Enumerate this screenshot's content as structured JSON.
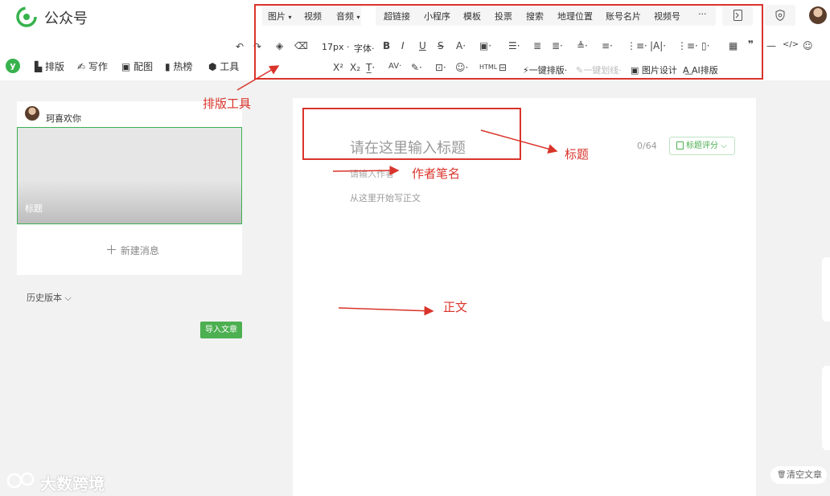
{
  "header": {
    "brand": "公众号",
    "insert_menu": [
      {
        "label": "图片",
        "arrow": "▾"
      },
      {
        "label": "视频",
        "arrow": ""
      },
      {
        "label": "音频",
        "arrow": "▾"
      },
      {
        "label": "超链接",
        "arrow": ""
      },
      {
        "label": "小程序",
        "arrow": ""
      },
      {
        "label": "模板",
        "arrow": ""
      },
      {
        "label": "投票",
        "arrow": ""
      },
      {
        "label": "搜索",
        "arrow": ""
      },
      {
        "label": "地理位置",
        "arrow": ""
      },
      {
        "label": "账号名片",
        "arrow": ""
      },
      {
        "label": "视频号",
        "arrow": ""
      },
      {
        "label": "···",
        "arrow": ""
      }
    ]
  },
  "format_toolbar": {
    "font_size": "17px",
    "font_family": "字体",
    "one_click_layout": "一键排版",
    "image_design": "图片设计",
    "ai_layout": "AI排版",
    "dim_label": "一键划线"
  },
  "features": [
    "排版",
    "写作",
    "配图",
    "热榜",
    "工具"
  ],
  "left_panel": {
    "author": "珂喜欢你",
    "cover_title": "标题",
    "new_message": "新建消息",
    "history": "历史版本",
    "import": "导入文章"
  },
  "editor": {
    "title_placeholder": "请在这里输入标题",
    "counter": "0/64",
    "title_score": "标题评分",
    "author_placeholder": "请输入作者",
    "body_placeholder": "从这里开始写正文"
  },
  "annotations": {
    "toolbar": "排版工具",
    "title": "标题",
    "author": "作者笔名",
    "body": "正文",
    "color": "#d9342b"
  },
  "footer": {
    "clear": "清空文章",
    "watermark": "大数跨境"
  }
}
